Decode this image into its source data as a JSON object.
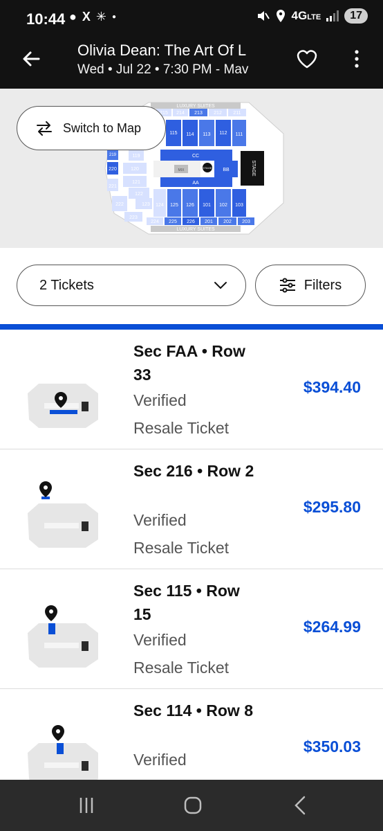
{
  "status_bar": {
    "time": "10:44",
    "network": "4G",
    "network_sub": "LTE",
    "notification_count": "17"
  },
  "header": {
    "title": "Olivia Dean: The Art Of L",
    "subtitle": "Wed • Jul 22 • 7:30 PM - Mav"
  },
  "map": {
    "switch_label": "Switch to Map",
    "top_label": "LUXURY SUITES",
    "bottom_label": "LUXURY SUITES",
    "stage_label": "STAGE",
    "stage_center_label": "STAGE",
    "mix_label": "MIX",
    "sections": {
      "s215": "215",
      "s214": "214",
      "s213": "213",
      "s212": "212",
      "s211": "211",
      "s115": "115",
      "s114": "114",
      "s113": "113",
      "s112": "112",
      "s111": "111",
      "s119": "119",
      "s120": "120",
      "s121": "121",
      "s122": "122",
      "s123": "123",
      "s220": "220",
      "s221": "221",
      "s222": "222",
      "s223": "223",
      "s219": "219",
      "s124": "124",
      "s125": "125",
      "s126": "126",
      "s101": "101",
      "s102": "102",
      "s103": "103",
      "s224": "224",
      "s225": "225",
      "s226": "226",
      "s201": "201",
      "s202": "202",
      "s203": "203",
      "cc": "CC",
      "bb": "BB",
      "aa": "AA"
    }
  },
  "controls": {
    "tickets_label": "2 Tickets",
    "filters_label": "Filters"
  },
  "listings": [
    {
      "section_row": "Sec FAA • Row 33",
      "line1": "Verified",
      "line2": "Resale Ticket",
      "price": "$394.40"
    },
    {
      "section_row": "Sec 216 • Row 2",
      "line1": "Verified",
      "line2": "Resale Ticket",
      "price": "$295.80"
    },
    {
      "section_row": "Sec 115 • Row 15",
      "line1": "Verified",
      "line2": "Resale Ticket",
      "price": "$264.99"
    },
    {
      "section_row": "Sec 114 • Row 8",
      "line1": "Verified",
      "line2": "",
      "price": "$350.03"
    }
  ],
  "colors": {
    "accent": "#0a4fd6",
    "header_bg": "#121212",
    "section_blue": "#4a78e8",
    "section_light": "#d7e1ff"
  }
}
